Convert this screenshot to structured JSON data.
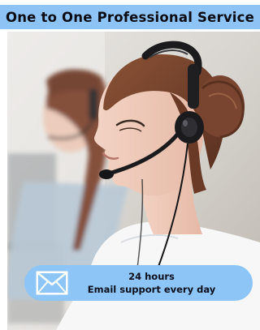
{
  "banner": {
    "title": "One to One Professional Service"
  },
  "photo": {
    "subject": "customer-support-agent-with-headset"
  },
  "email_badge": {
    "icon": "mail-icon",
    "line1": "24 hours",
    "line2": "Email support every day"
  },
  "colors": {
    "banner_bg": "#8ec4f5",
    "badge_bg": "#8cc5f6",
    "text": "#0c0c14"
  }
}
